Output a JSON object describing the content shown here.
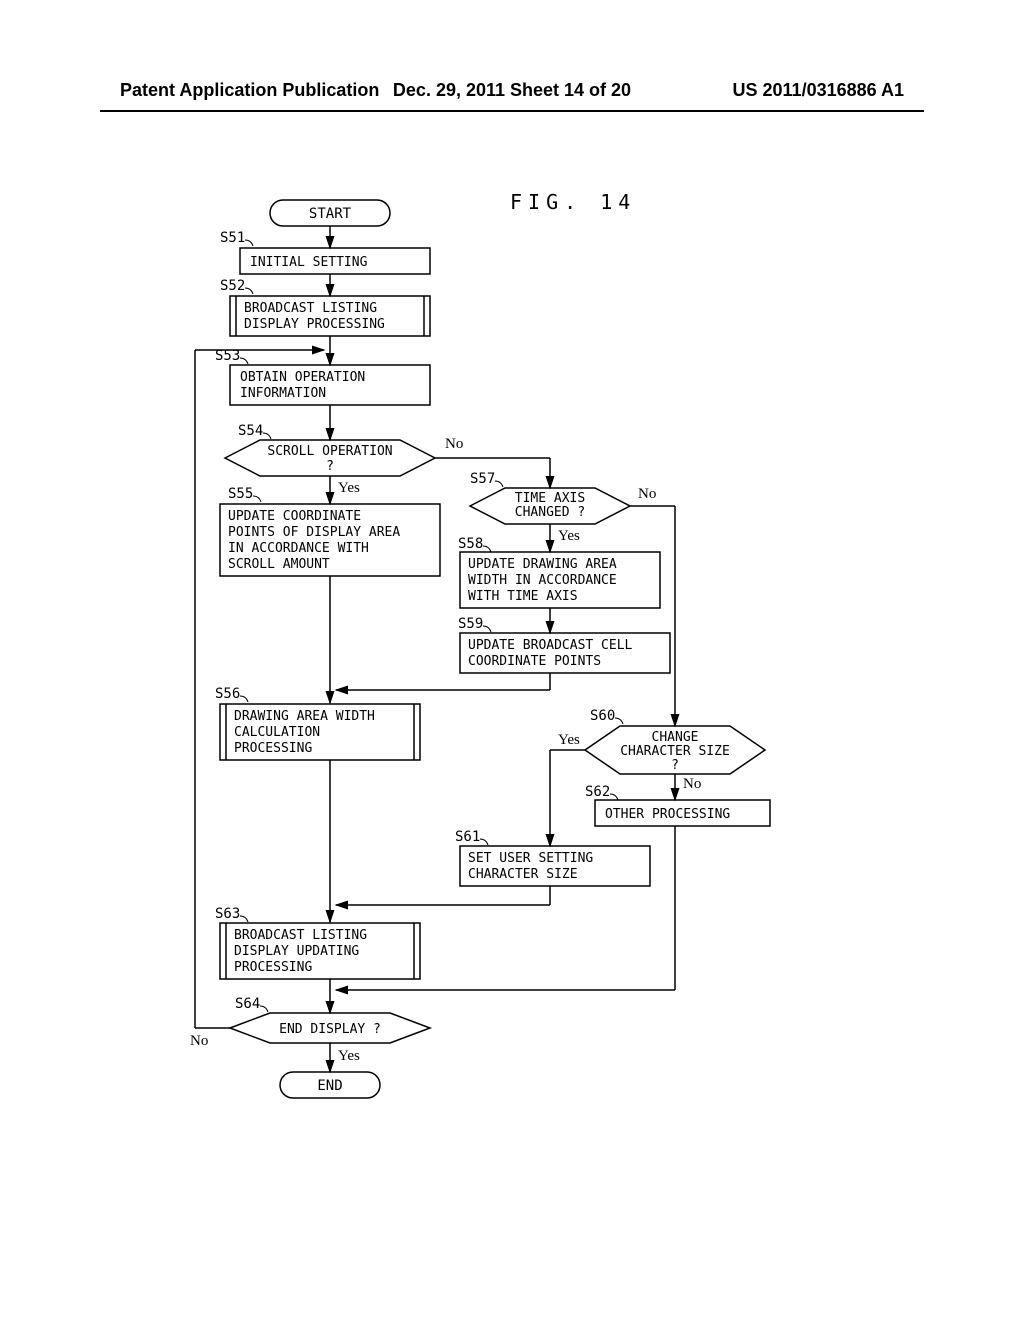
{
  "header": {
    "left": "Patent Application Publication",
    "center": "Dec. 29, 2011  Sheet 14 of 20",
    "right": "US 2011/0316886 A1"
  },
  "figure_label": "FIG. 14",
  "nodes": {
    "start": "START",
    "s51": {
      "tag": "S51",
      "text": "INITIAL SETTING"
    },
    "s52": {
      "tag": "S52",
      "text": "BROADCAST LISTING\nDISPLAY PROCESSING"
    },
    "s53": {
      "tag": "S53",
      "text": "OBTAIN OPERATION\nINFORMATION"
    },
    "s54": {
      "tag": "S54",
      "text": "SCROLL OPERATION\n?"
    },
    "s55": {
      "tag": "S55",
      "text": "UPDATE COORDINATE\nPOINTS OF DISPLAY AREA\nIN ACCORDANCE WITH\nSCROLL AMOUNT"
    },
    "s56": {
      "tag": "S56",
      "text": "DRAWING AREA WIDTH\nCALCULATION\nPROCESSING"
    },
    "s57": {
      "tag": "S57",
      "text": "TIME AXIS\nCHANGED ?"
    },
    "s58": {
      "tag": "S58",
      "text": "UPDATE DRAWING AREA\nWIDTH IN ACCORDANCE\nWITH TIME AXIS"
    },
    "s59": {
      "tag": "S59",
      "text": "UPDATE BROADCAST CELL\nCOORDINATE POINTS"
    },
    "s60": {
      "tag": "S60",
      "text": "CHANGE\nCHARACTER SIZE\n?"
    },
    "s61": {
      "tag": "S61",
      "text": "SET USER SETTING\nCHARACTER SIZE"
    },
    "s62": {
      "tag": "S62",
      "text": "OTHER PROCESSING"
    },
    "s63": {
      "tag": "S63",
      "text": "BROADCAST LISTING\nDISPLAY UPDATING\nPROCESSING"
    },
    "s64": {
      "tag": "S64",
      "text": "END DISPLAY ?"
    },
    "end": "END"
  },
  "labels": {
    "yes": "Yes",
    "no": "No"
  }
}
